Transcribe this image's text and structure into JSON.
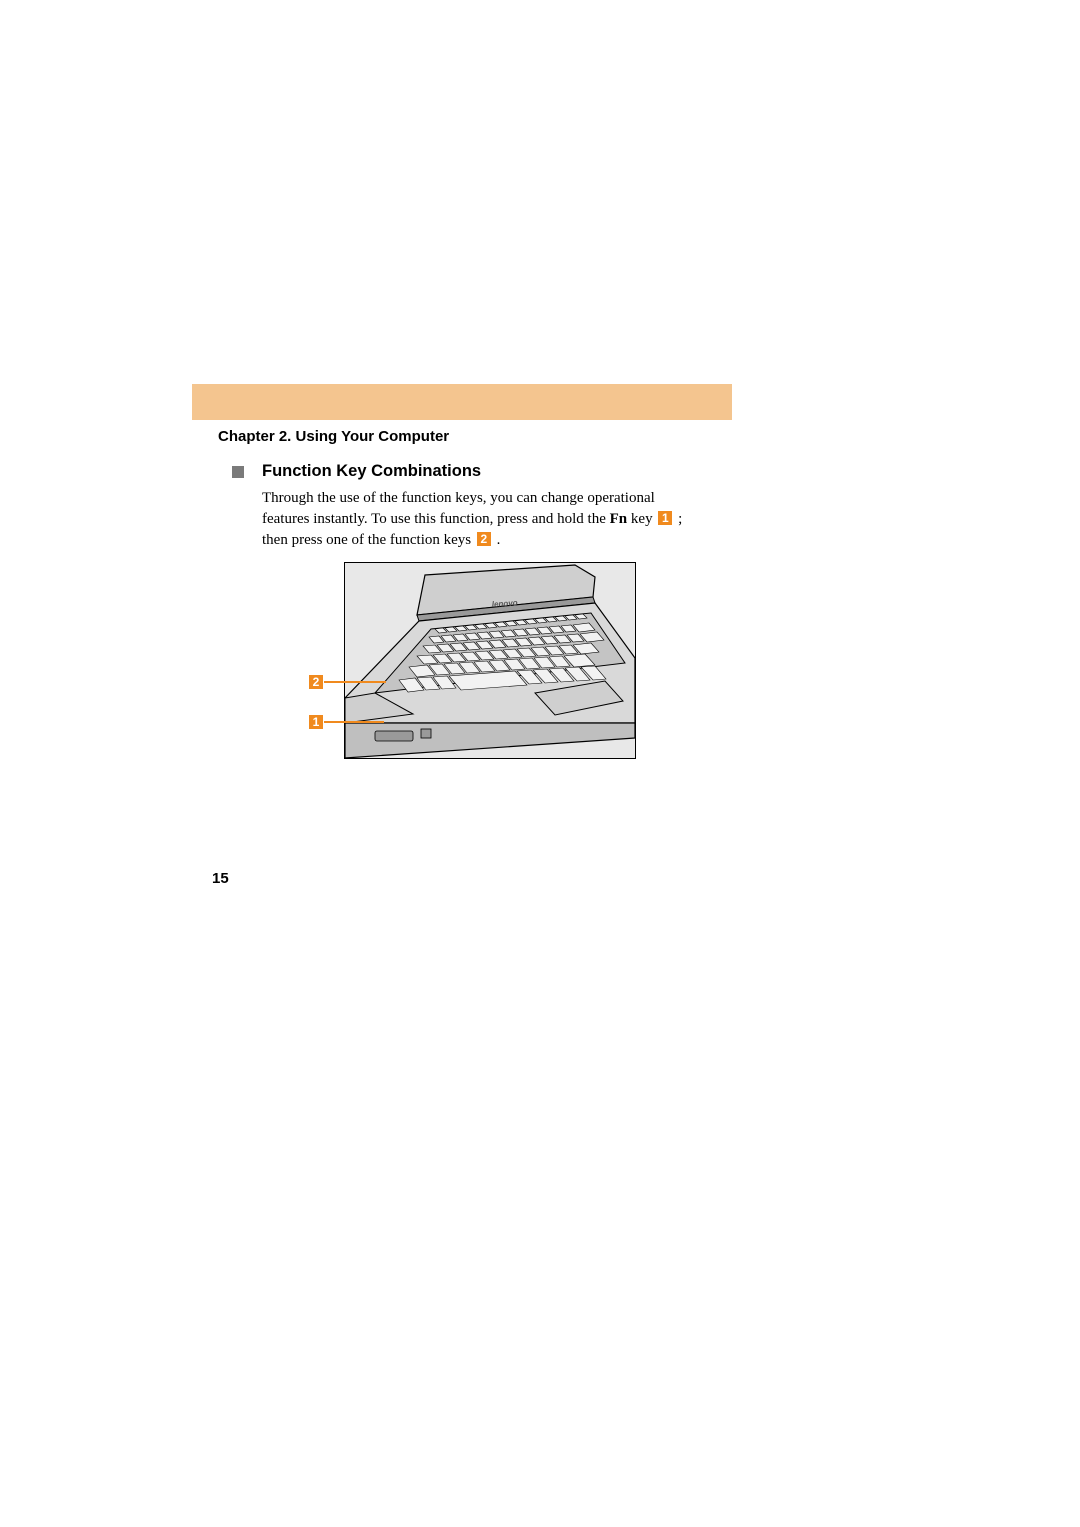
{
  "chapter_title": "Chapter 2. Using Your Computer",
  "section_title": "Function Key Combinations",
  "paragraph": {
    "part1": "Through the use of the function keys, you can change operational features instantly. To use this function, press and hold the ",
    "fn_label": "Fn",
    "part2": " key ",
    "badge1": "1",
    "part3": " ; then press one of the function keys ",
    "badge2": "2",
    "part4": " ."
  },
  "callouts": {
    "one": "1",
    "two": "2"
  },
  "figure": {
    "brand": "lenovo"
  },
  "page_number": "15",
  "colors": {
    "accent_orange": "#f08a1e",
    "header_peach": "#f4c58f",
    "bullet_gray": "#7a7a7a"
  }
}
